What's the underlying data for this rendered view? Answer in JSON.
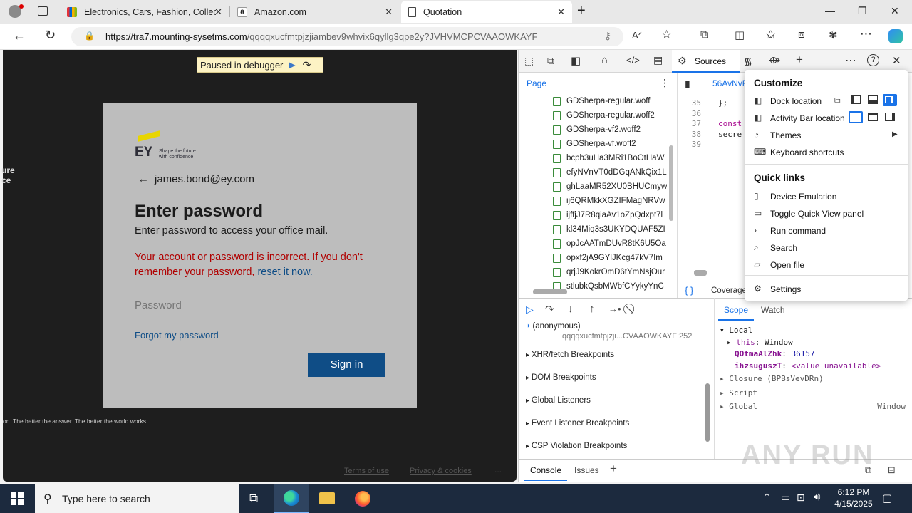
{
  "browser": {
    "tabs": [
      {
        "label": "Electronics, Cars, Fashion, Collec",
        "active": false
      },
      {
        "label": "Amazon.com",
        "active": false
      },
      {
        "label": "Quotation",
        "active": true
      }
    ],
    "url_domain": "https://tra7.mounting-sysetms.com",
    "url_path": "/qqqqxucfmtpjzjiambev9whvix6qyllg3qpe2y?JVHVMCPCVAAOWKAYF"
  },
  "page": {
    "debugger_label": "Paused in debugger",
    "side_text": [
      "ure",
      "ce"
    ],
    "footer_tagline": "on. The better the answer. The better the world works.",
    "footer_links": [
      "Terms of use",
      "Privacy & cookies",
      "..."
    ],
    "logo": {
      "text": "EY",
      "tagline_1": "Shape the future",
      "tagline_2": "with confidence"
    },
    "email": "james.bond@ey.com",
    "heading": "Enter password",
    "subheading": "Enter password to access your office mail.",
    "error_text": "Your account or password is incorrect. If you don't remember your password,",
    "reset_link": "reset it now.",
    "password_placeholder": "Password",
    "forgot_link": "Forgot my password",
    "sign_in": "Sign in",
    "colors": {
      "error": "#b00000",
      "primary": "#0f4d86",
      "link": "#0f4d86"
    }
  },
  "devtools": {
    "sources_tab": "Sources",
    "page_tab": "Page",
    "files": [
      "GDSherpa-regular.woff",
      "GDSherpa-regular.woff2",
      "GDSherpa-vf2.woff2",
      "GDSherpa-vf.woff2",
      "bcpb3uHa3MRi1BoOtHaW",
      "efyNVnVT0dDGqANkQix1L",
      "ghLaaMR52XU0BHUCmyw",
      "ij6QRMkkXGZIFMagNRVw",
      "ijffjJ7R8qiaAv1oZpQdxpt7l",
      "kl34Miq3s3UKYDQUAF5ZI",
      "opJcAATmDUvR8tK6U5Oa",
      "opxf2jA9GYlJKcg47kV7Im",
      "qrjJ9KokrOmD6tYmNsjOur",
      "stlubkQsbMWbfCYykyYnC"
    ],
    "editor_tab": "56AvNvR",
    "line_numbers": [
      "35",
      "36",
      "37",
      "38",
      "39"
    ],
    "code_lines": [
      "};",
      "",
      "const",
      "secre",
      ""
    ],
    "coverage_label": "Coverage",
    "callstack": {
      "fn": "(anonymous)",
      "loc": "qqqqxucfmtpjzji...CVAAOWKAYF:252"
    },
    "breakpoints": [
      "XHR/fetch Breakpoints",
      "DOM Breakpoints",
      "Global Listeners",
      "Event Listener Breakpoints",
      "CSP Violation Breakpoints"
    ],
    "scope_tabs": [
      "Scope",
      "Watch"
    ],
    "scope": {
      "local": "Local",
      "this_key": "this",
      "this_val": "Window",
      "var1_key": "QOtmaAlZhk",
      "var1_val": "36157",
      "var2_key": "ihzsuguszT",
      "var2_val": "<value unavailable>",
      "closure": "Closure (BPBsVevDRn)",
      "script": "Script",
      "global": "Global",
      "global_val": "Window"
    },
    "drawer_tabs": [
      "Console",
      "Issues"
    ],
    "menu": {
      "customize": "Customize",
      "dock_location": "Dock location",
      "activity_bar_location": "Activity Bar location",
      "themes": "Themes",
      "keyboard_shortcuts": "Keyboard shortcuts",
      "quick_links": "Quick links",
      "device_emulation": "Device Emulation",
      "toggle_quick_view": "Toggle Quick View panel",
      "run_command": "Run command",
      "search": "Search",
      "open_file": "Open file",
      "settings": "Settings"
    }
  },
  "taskbar": {
    "search_placeholder": "Type here to search",
    "time": "6:12 PM",
    "date": "4/15/2025"
  },
  "watermark": "ANY RUN"
}
